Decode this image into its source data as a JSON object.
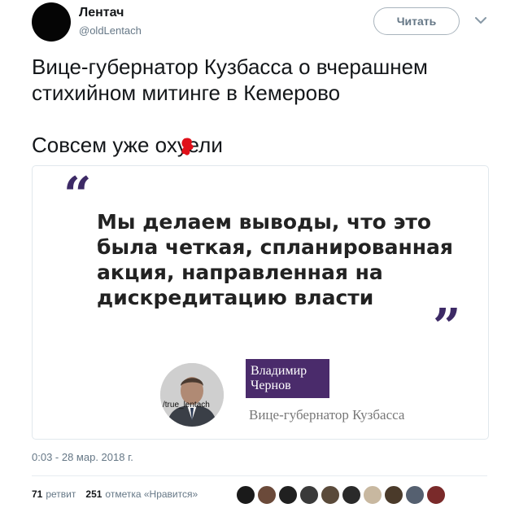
{
  "author": {
    "display_name": "Лентач",
    "handle": "@oldLentach"
  },
  "follow_button_label": "Читать",
  "tweet": {
    "text_lines": [
      "Вице-губернатор Кузбасса о вчерашнем",
      "стихийном митинге в Кемерово"
    ],
    "comment": "Совсем уже охуели"
  },
  "media": {
    "quote_lines": [
      "Мы делаем выводы, что это",
      "была четкая, спланированная",
      "акция, направленная на",
      "дискредитацию власти"
    ],
    "quote_open": "“",
    "quote_close": "”",
    "watermark": "/true_lentach",
    "speaker_name_lines": [
      "Владимир",
      "Чернов"
    ],
    "speaker_role": "Вице-губернатор Кузбасса",
    "accent_color": "#4a2b6b"
  },
  "timestamp": "0:03 - 28 мар. 2018 г.",
  "stats": {
    "retweets_count": "71",
    "retweets_label": "ретвит",
    "likes_count": "251",
    "likes_label": "отметка «Нравится»"
  },
  "likers_colors": [
    "#1a1a1a",
    "#6b4a3a",
    "#202020",
    "#3a3a3a",
    "#5a4a3a",
    "#2a2a2a",
    "#c8b8a0",
    "#4a3a2a",
    "#556070",
    "#7a2a2a"
  ]
}
